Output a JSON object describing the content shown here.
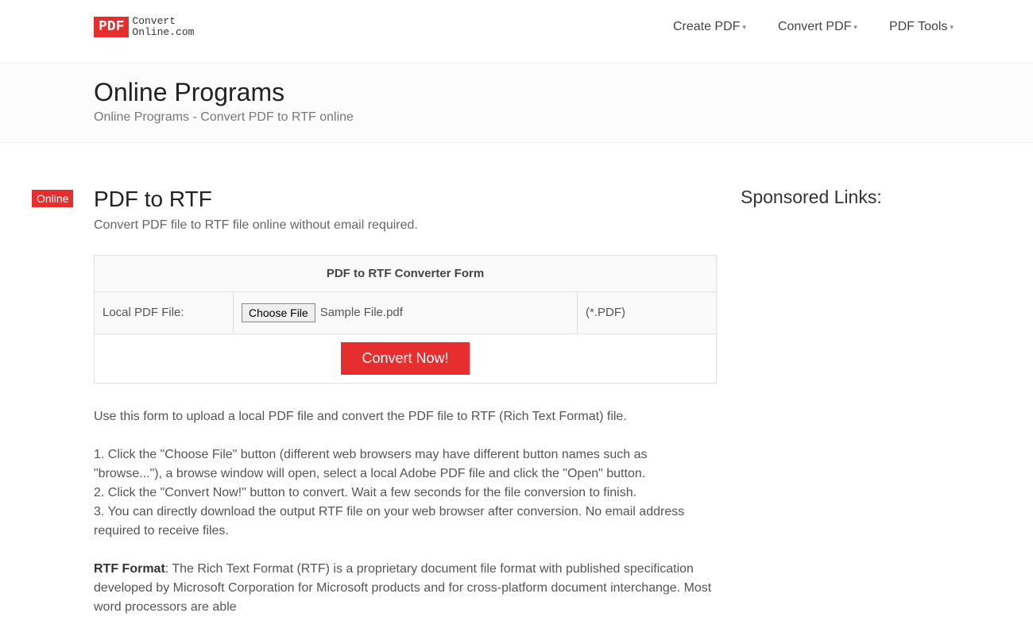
{
  "logo": {
    "badge": "PDF",
    "line1": "Convert",
    "line2": "Online.com"
  },
  "nav": {
    "create": "Create PDF",
    "convert": "Convert PDF",
    "tools": "PDF Tools"
  },
  "titleSection": {
    "title": "Online Programs",
    "subtitle": "Online Programs - Convert PDF to RTF online"
  },
  "onlineBadge": "Online",
  "main": {
    "title": "PDF to RTF",
    "subtitle": "Convert PDF file to RTF file online without email required.",
    "formHeader": "PDF to RTF Converter Form",
    "labelLocalFile": "Local PDF File:",
    "chooseFile": "Choose File",
    "fileName": "Sample File.pdf",
    "fileExt": "(*.PDF)",
    "convertNow": "Convert Now!",
    "intro": "Use this form to upload a local PDF file and convert the PDF file to RTF (Rich Text Format) file.",
    "step1": "1. Click the \"Choose File\" button (different web browsers may have different button names such as \"browse...\"), a browse window will open, select a local Adobe PDF file and click the \"Open\" button.",
    "step2": "2. Click the \"Convert Now!\" button to convert. Wait a few seconds for the file conversion to finish.",
    "step3": "3. You can directly download the output RTF file on your web browser after conversion. No email address required to receive files.",
    "rtfLabel": "RTF Format",
    "rtfDesc": ": The Rich Text Format (RTF) is a proprietary document file format with published specification developed by Microsoft Corporation for Microsoft products and for cross-platform document interchange. Most word processors are able"
  },
  "sidebar": {
    "sponsored": "Sponsored Links:"
  }
}
